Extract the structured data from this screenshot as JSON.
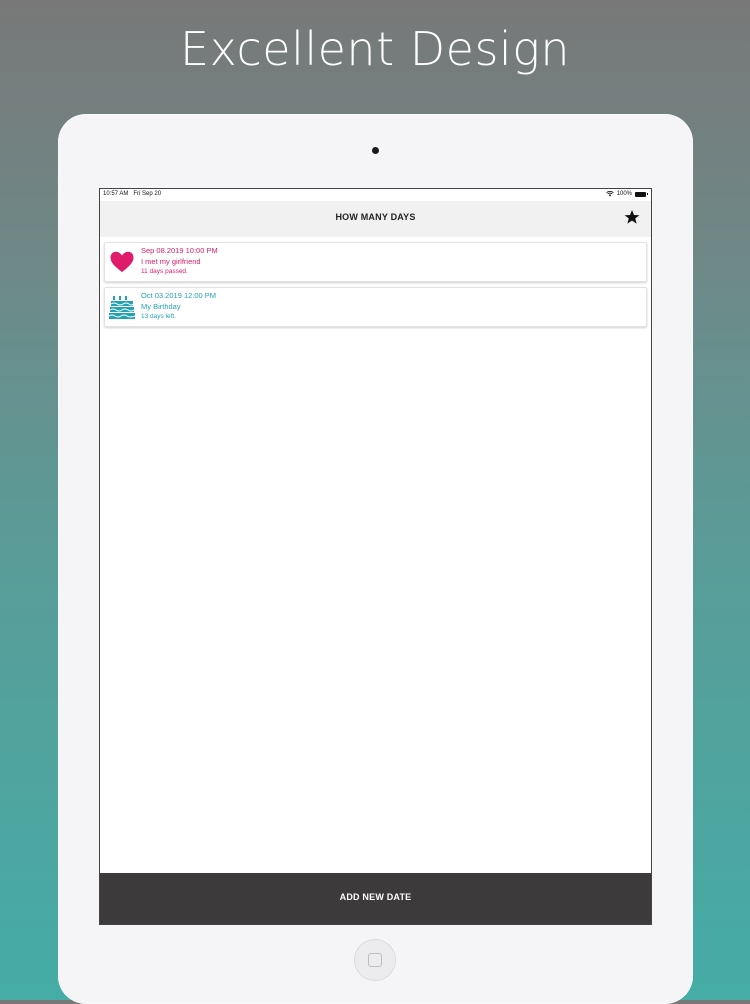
{
  "headline": "Excellent Design",
  "status_bar": {
    "time": "10:57 AM",
    "date": "Fri Sep 20",
    "battery": "100%"
  },
  "nav": {
    "title": "HOW MANY DAYS",
    "favorite_icon": "star-icon"
  },
  "events": [
    {
      "icon": "heart-icon",
      "color": "#e01b6a",
      "date": "Sep 08.2019 10:00 PM",
      "title": "I met my girlfriend",
      "status": "11 days passed."
    },
    {
      "icon": "birthday-cake-icon",
      "color": "#23a2b6",
      "date": "Oct 03.2019 12:00 PM",
      "title": "My Birthday",
      "status": "13 days left."
    }
  ],
  "bottom_bar": {
    "label": "ADD NEW DATE"
  }
}
